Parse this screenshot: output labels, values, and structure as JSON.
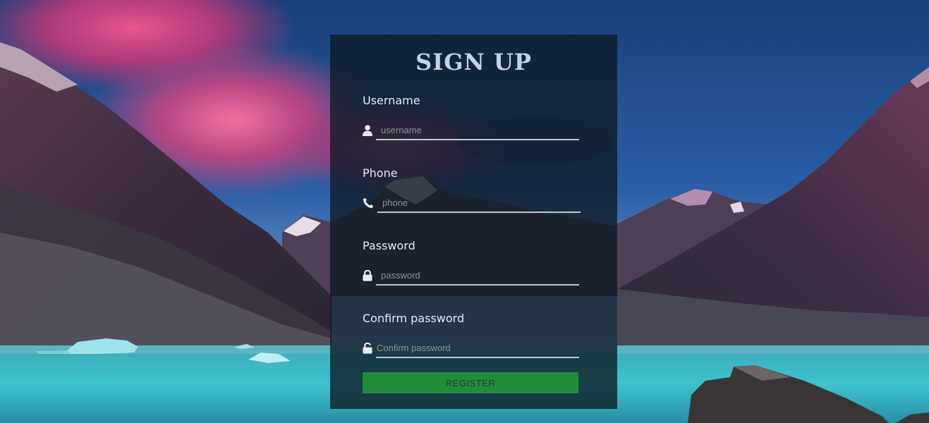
{
  "form": {
    "title": "SIGN UP",
    "fields": [
      {
        "label": "Username",
        "placeholder": "username",
        "value": "",
        "icon": "user-icon"
      },
      {
        "label": "Phone",
        "placeholder": "phone",
        "value": "",
        "icon": "phone-icon"
      },
      {
        "label": "Password",
        "placeholder": "password",
        "value": "",
        "icon": "lock-icon"
      },
      {
        "label": "Confirm password",
        "placeholder": "Confirm password",
        "value": "",
        "icon": "unlock-icon"
      }
    ],
    "register_label": "REGISTER"
  },
  "colors": {
    "title": "#b9d6ea",
    "button": "#238c3c",
    "card_background": "rgba(14, 26, 34, 0.78)"
  }
}
